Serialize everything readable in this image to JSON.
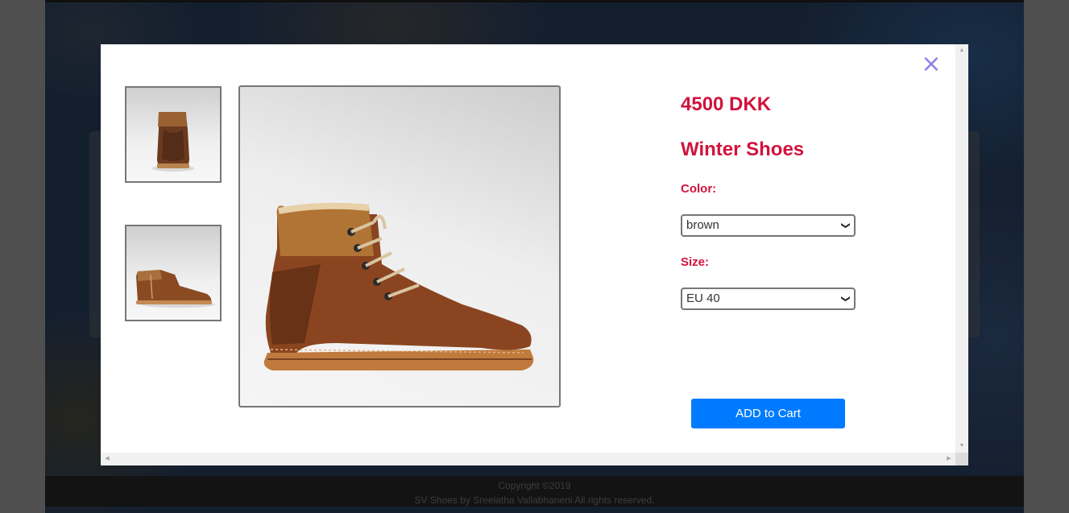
{
  "product": {
    "price": "4500 DKK",
    "name": "Winter Shoes",
    "color_label": "Color:",
    "color_value": "brown",
    "size_label": "Size:",
    "size_value": "EU 40",
    "add_to_cart_label": "ADD to Cart"
  },
  "modal": {
    "close_icon": "×"
  },
  "footer": {
    "copyright": "Copyright ©2019",
    "credits": "SV Shoes by Sreelatha Vallabhaneni All rights reserved."
  },
  "colors": {
    "accent_red": "#d0133d",
    "button_blue": "#007bff",
    "close_purple": "#8f7fe8"
  },
  "icons": {
    "close": "close-icon",
    "select_chevron": "chevron-down-icon"
  }
}
